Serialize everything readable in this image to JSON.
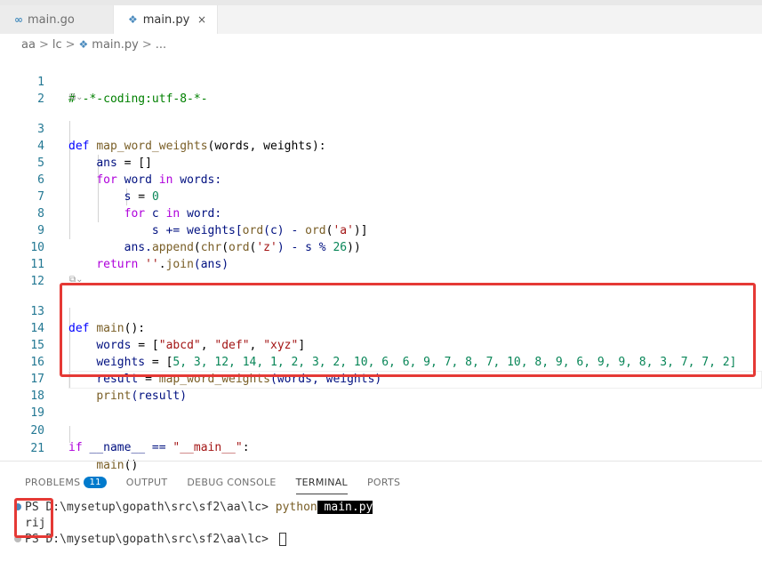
{
  "tabs": [
    {
      "label": "main.go",
      "icon": "go-icon",
      "active": false
    },
    {
      "label": "main.py",
      "icon": "python-icon",
      "active": true,
      "close": "×"
    }
  ],
  "breadcrumb": {
    "parts": [
      "aa",
      "lc",
      "main.py",
      "..."
    ]
  },
  "codelens": "⧉⌄",
  "line_numbers": [
    "1",
    "2",
    "3",
    "4",
    "5",
    "6",
    "7",
    "8",
    "9",
    "10",
    "11",
    "12",
    "13",
    "14",
    "15",
    "16",
    "17",
    "18",
    "19",
    "20",
    "21"
  ],
  "code": {
    "l1": "# -*-coding:utf-8-*-",
    "l3_def": "def",
    "l3_fn": "map_word_weights",
    "l3_rest": "(words, weights):",
    "l4_var": "ans",
    "l4_rest": " = []",
    "l5_for": "for",
    "l5_a": " word ",
    "l5_in": "in",
    "l5_b": " words:",
    "l6_var": "s",
    "l6_op": " = ",
    "l6_num": "0",
    "l7_for": "for",
    "l7_a": " c ",
    "l7_in": "in",
    "l7_b": " word:",
    "l8_a": "s += weights[",
    "l8_fn1": "ord",
    "l8_b": "(c) - ",
    "l8_fn2": "ord",
    "l8_c": "(",
    "l8_str": "'a'",
    "l8_d": ")]",
    "l9_a": "ans.",
    "l9_fn": "append",
    "l9_b": "(",
    "l9_fn2": "chr",
    "l9_c": "(",
    "l9_fn3": "ord",
    "l9_d": "(",
    "l9_str": "'z'",
    "l9_e": ") - s % ",
    "l9_num": "26",
    "l9_f": "))",
    "l10_ret": "return",
    "l10_sp": " ",
    "l10_str": "''",
    "l10_a": ".",
    "l10_fn": "join",
    "l10_b": "(ans)",
    "l13_def": "def",
    "l13_fn": "main",
    "l13_rest": "():",
    "l14_var": "words",
    "l14_a": " = [",
    "l14_s1": "\"abcd\"",
    "l14_c1": ", ",
    "l14_s2": "\"def\"",
    "l14_c2": ", ",
    "l14_s3": "\"xyz\"",
    "l14_b": "]",
    "l15_var": "weights",
    "l15_a": " = [",
    "l15_nums": "5, 3, 12, 14, 1, 2, 3, 2, 10, 6, 6, 9, 7, 8, 7, 10, 8, 9, 6, 9, 9, 8, 3, 7, 7, 2]",
    "l16_var": "result",
    "l16_a": " = ",
    "l16_fn": "map_word_weights",
    "l16_b": "(words, weights)",
    "l17_fn": "print",
    "l17_b": "(result)",
    "l20_if": "if",
    "l20_a": " __name__ == ",
    "l20_str": "\"__main__\"",
    "l20_b": ":",
    "l21_fn": "main",
    "l21_b": "()"
  },
  "panel": {
    "tabs": [
      "PROBLEMS",
      "OUTPUT",
      "DEBUG CONSOLE",
      "TERMINAL",
      "PORTS"
    ],
    "problems_count": "11",
    "active": "TERMINAL"
  },
  "terminal": {
    "prompt1": "PS D:\\mysetup\\gopath\\src\\sf2\\aa\\lc> ",
    "cmd": "python",
    "arg": " main.py",
    "output": "rij",
    "prompt2": "PS D:\\mysetup\\gopath\\src\\sf2\\aa\\lc> "
  },
  "colors": {
    "accent": "#007acc",
    "highlight": "#e53935"
  }
}
